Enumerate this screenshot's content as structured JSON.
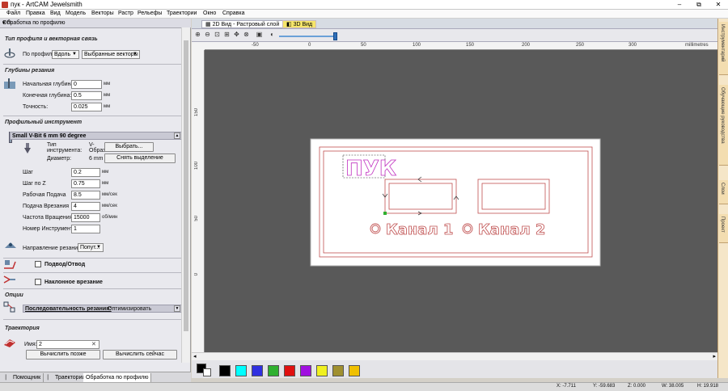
{
  "window": {
    "title": "пук - ArtCAM Jewelsmith",
    "minimize": "‒",
    "maximize": "⧉",
    "close": "✕"
  },
  "menu": [
    "Файл",
    "Правка",
    "Вид",
    "Модель",
    "Векторы",
    "Растр",
    "Рельефы",
    "Траектории",
    "Окно",
    "Справка"
  ],
  "panel": {
    "title": "Обработка по профилю",
    "pin": "▾ ⊓",
    "section_profile": "Тип профиля и векторная связь",
    "by_profile_label": "По профилю",
    "by_profile_value": "Вдоль",
    "vectors_value": "Выбранные векторы",
    "section_depth": "Глубины резания",
    "start_depth_label": "Начальная глубина:",
    "start_depth": "0",
    "end_depth_label": "Конечная глубина:",
    "end_depth": "0.5",
    "tolerance_label": "Точность:",
    "tolerance": "0.025",
    "unit_mm": "мм",
    "section_tool": "Профильный инструмент",
    "tool_name": "Small V-Bit 6 mm 90 degree",
    "tool_up_arrow": "▲",
    "tool_type_label": "Тип инструмента:",
    "tool_type_value": "V-Образный",
    "diameter_label": "Диаметр:",
    "diameter_value": "6 mm",
    "select_btn": "Выбрать...",
    "clear_btn": "Снять выделение",
    "step_label": "Шаг",
    "step": "0.2",
    "stepz_label": "Шаг по Z",
    "stepz": "0.75",
    "feed_label": "Рабочая Подача",
    "feed": "8.5",
    "plunge_label": "Подача Врезания",
    "plunge": "4",
    "speed_label": "Частота Вращения",
    "speed": "15000",
    "toolno_label": "Номер Инструмента",
    "toolno": "1",
    "unit_mms": "мм/сек",
    "unit_rpm": "об/мин",
    "direction_label": "Направление резания:",
    "direction_value": "Попут...",
    "leadin_label": "Подвод/Отвод",
    "ramp_label": "Наклонное врезание",
    "section_options": "Опции",
    "sequence_label": "Последовательность резания:",
    "sequence_value": "Оптимизировать",
    "section_toolpath": "Траектория",
    "name_label": "Имя:",
    "name_value": "2",
    "later_btn": "Вычислить позже",
    "now_btn": "Вычислить сейчас"
  },
  "bottom_tabs": [
    "Помощник",
    "Траектории",
    "Обработка по профилю"
  ],
  "view_tabs": [
    "2D Вид - Растровый слой",
    "3D Вид"
  ],
  "ruler": {
    "h_labels": [
      "-50",
      "0",
      "50",
      "100",
      "150",
      "200",
      "250",
      "300"
    ],
    "h_unit": "millimetres",
    "v_labels": [
      "150",
      "100",
      "50",
      "0"
    ]
  },
  "canvas": {
    "text_main": "ПУК",
    "channel1": "Канал 1",
    "channel2": "Канал 2"
  },
  "right_tabs": [
    "Инструментарий",
    "Обучающие руководства",
    "Слои",
    "Проект"
  ],
  "palette": [
    "#000000",
    "#ffffff",
    "#000000",
    "#00ffff",
    "#3030e0",
    "#30b030",
    "#e01010",
    "#a010e0",
    "#f0f020",
    "#a09030",
    "#f0c000"
  ],
  "status": {
    "x": "X: -7.711",
    "y": "Y: -59.683",
    "z": "Z: 0.000",
    "w": "W: 38.005",
    "h": "H: 19.918"
  }
}
